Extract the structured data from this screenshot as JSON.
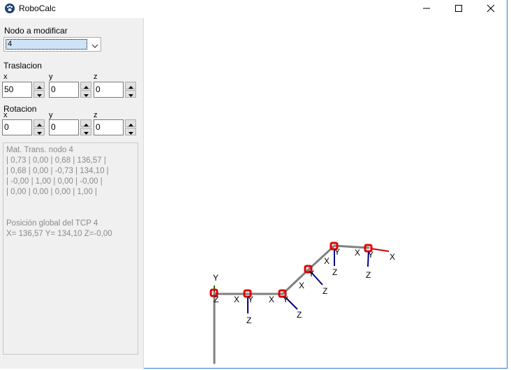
{
  "window": {
    "title": "RoboCalc",
    "app_icon": "paw-icon",
    "controls": [
      "minimize-icon",
      "maximize-icon",
      "close-icon"
    ]
  },
  "panel": {
    "node_label": "Nodo a modificar",
    "node_value": "4",
    "translation_label": "Traslacion",
    "rotation_label": "Rotacion",
    "axis_x": "x",
    "axis_y": "y",
    "axis_z": "z",
    "translation": {
      "x": "50",
      "y": "0",
      "z": "0"
    },
    "rotation": {
      "x": "0",
      "y": "0",
      "z": "0"
    }
  },
  "info": {
    "matrix_title": "Mat. Trans. nodo 4",
    "matrix_rows": [
      "| 0,73 | 0,00 | 0,68 | 136,57 |",
      "| 0,68 | 0,00 | -0,73 | 134,10 |",
      "| -0,00 | 1,00 | 0,00 | -0,00 |",
      "| 0,00 | 0,00 | 0,00 | 1,00 |"
    ],
    "tcp_title": "Posición global del TCP 4",
    "tcp_position": "X= 136,57 Y= 134,10 Z=-0,00"
  },
  "viewport": {
    "axis_labels": {
      "x": "X",
      "y": "Y",
      "z": "Z"
    },
    "colors": {
      "link": "#808080",
      "joint": "#e00000",
      "z_axis": "#00008b",
      "x_axis": "#cc0000",
      "y_axis": "#008000"
    }
  }
}
